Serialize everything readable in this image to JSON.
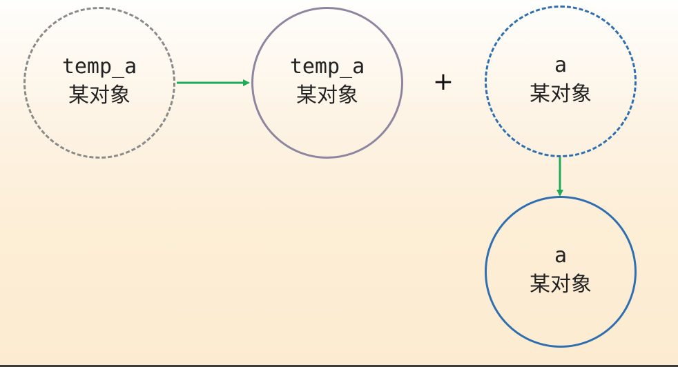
{
  "nodes": [
    {
      "id": "node-1",
      "label": "temp_a",
      "value": "某对象"
    },
    {
      "id": "node-2",
      "label": "temp_a",
      "value": "某对象"
    },
    {
      "id": "node-3",
      "label": "a",
      "value": "某对象"
    },
    {
      "id": "node-4",
      "label": "a",
      "value": "某对象"
    }
  ],
  "operator": "+",
  "colors": {
    "arrow": "#1faa59",
    "gray_outline": "#8a8a8a",
    "purple_outline": "#8e86a0",
    "blue_outline": "#2f6fb0"
  }
}
